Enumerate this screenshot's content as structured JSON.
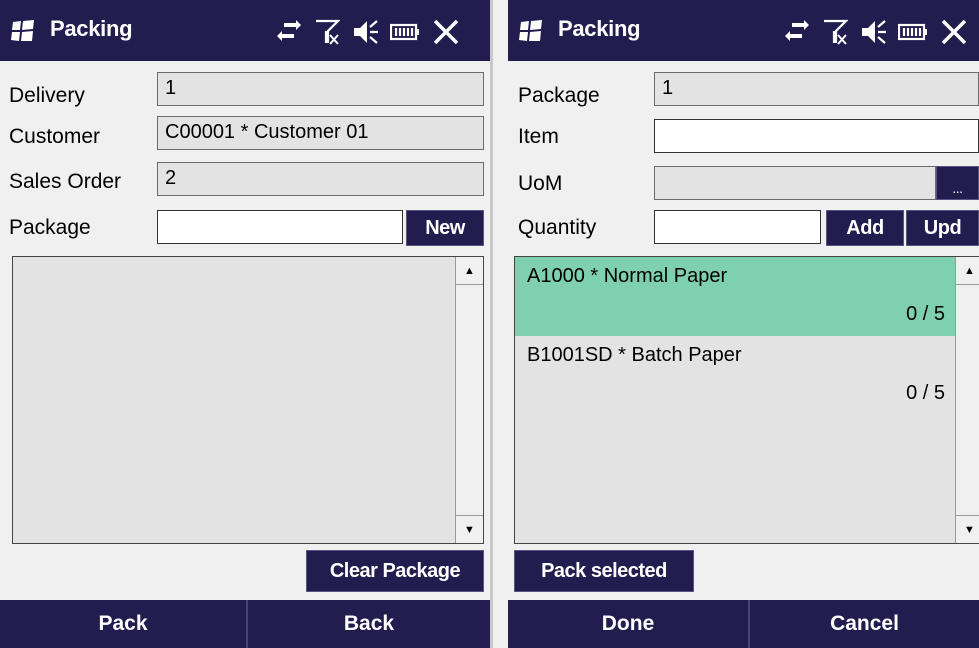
{
  "left_screen": {
    "title": "Packing",
    "fields": {
      "delivery_label": "Delivery",
      "delivery_value": "1",
      "customer_label": "Customer",
      "customer_value": "C00001 * Customer 01",
      "sales_order_label": "Sales Order",
      "sales_order_value": "2",
      "package_label": "Package",
      "package_value": ""
    },
    "new_button": "New",
    "clear_package_button": "Clear Package",
    "bottom_bar": {
      "pack": "Pack",
      "back": "Back"
    }
  },
  "right_screen": {
    "title": "Packing",
    "fields": {
      "package_label": "Package",
      "package_value": "1",
      "item_label": "Item",
      "item_value": "",
      "uom_label": "UoM",
      "uom_value": "",
      "quantity_label": "Quantity",
      "quantity_value": ""
    },
    "browse_button": "...",
    "add_button": "Add",
    "upd_button": "Upd",
    "items": [
      {
        "name": "A1000 * Normal Paper",
        "qty": "0 / 5",
        "selected": true
      },
      {
        "name": "B1001SD * Batch Paper",
        "qty": "0 / 5",
        "selected": false
      }
    ],
    "pack_selected_button": "Pack selected",
    "bottom_bar": {
      "done": "Done",
      "cancel": "Cancel"
    }
  },
  "icons": [
    "windows-logo-icon",
    "connectivity-icon",
    "signal-off-icon",
    "speaker-mute-icon",
    "battery-icon",
    "close-icon"
  ],
  "colors": {
    "bar": "#231d4f",
    "selected_row": "#7fcfb1",
    "readonly_field": "#e3e3e3",
    "background": "#f0f0f0"
  }
}
